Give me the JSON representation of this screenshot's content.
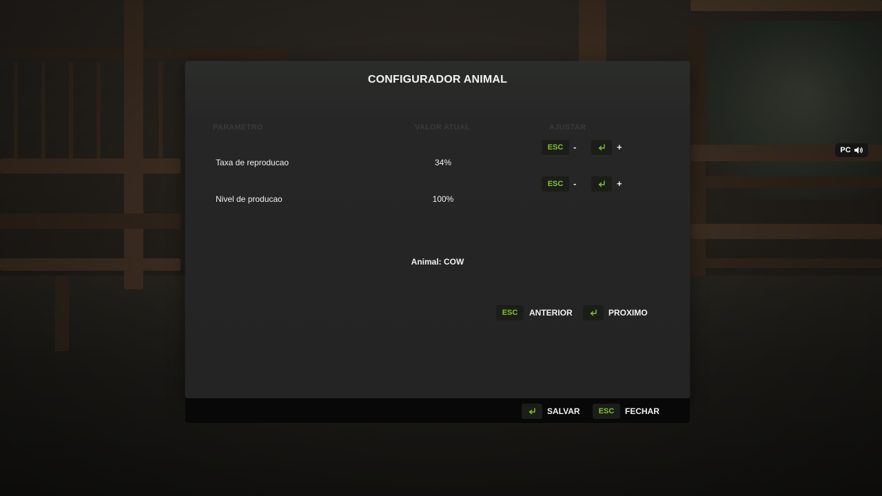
{
  "dialog": {
    "title": "CONFIGURADOR ANIMAL",
    "columns": {
      "parameter": "PARAMETRO",
      "current_value": "VALOR ATUAL",
      "adjust": "AJUSTAR"
    },
    "rows": [
      {
        "label": "Taxa de reproducao",
        "value": "34%",
        "decrease_key": "ESC",
        "decrease_symbol": "-",
        "increase_symbol": "+"
      },
      {
        "label": "Nivel de producao",
        "value": "100%",
        "decrease_key": "ESC",
        "decrease_symbol": "-",
        "increase_symbol": "+"
      }
    ],
    "animal_label": "Animal: COW",
    "nav": {
      "previous_key": "ESC",
      "previous_label": "ANTERIOR",
      "next_label": "PROXIMO"
    }
  },
  "footer": {
    "save_label": "SALVAR",
    "close_key": "ESC",
    "close_label": "FECHAR"
  },
  "platform_badge": {
    "label": "PC"
  },
  "colors": {
    "accent_green": "#86c234",
    "panel": "#262626",
    "footer": "#080808"
  },
  "icons": {
    "confirm": "enter-key-icon",
    "speaker": "speaker-icon"
  }
}
